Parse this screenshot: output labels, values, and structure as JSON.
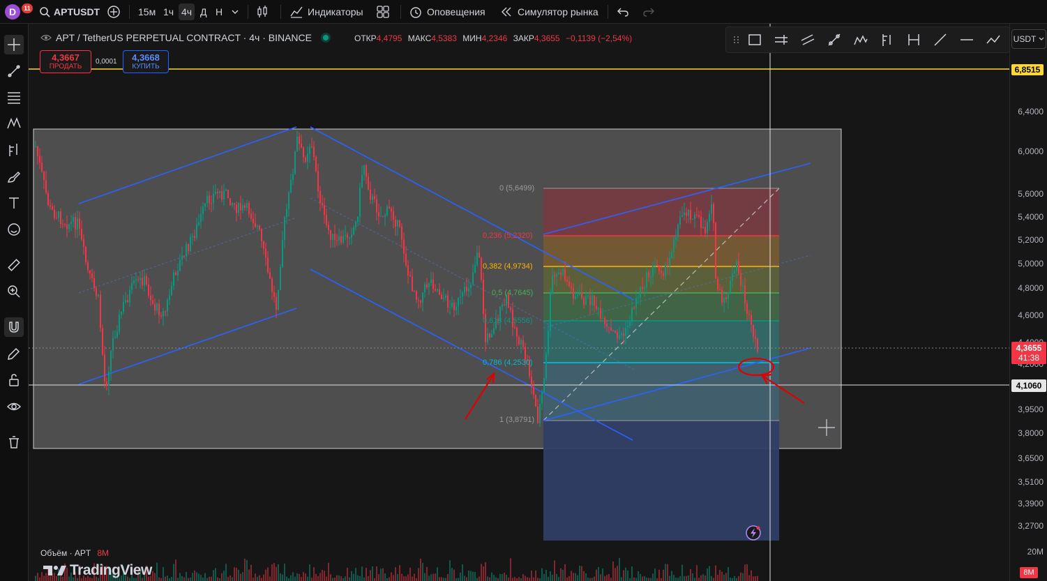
{
  "topbar": {
    "avatar_letter": "D",
    "notifications": "11",
    "symbol": "APTUSDT",
    "timeframes": [
      "15м",
      "1ч",
      "4ч",
      "Д",
      "Н"
    ],
    "active_timeframe": "4ч",
    "indicators_label": "Индикаторы",
    "alerts_label": "Оповещения",
    "replay_label": "Симулятор рынка"
  },
  "legend": {
    "title": "APT / TetherUS PERPETUAL CONTRACT · 4ч · BINANCE",
    "open_label": "ОТКР",
    "open": "4,4795",
    "high_label": "МАКС",
    "high": "4,5383",
    "low_label": "МИН",
    "low": "4,2346",
    "close_label": "ЗАКР",
    "close": "4,3655",
    "change": "−0,1139 (−2,54%)"
  },
  "trade": {
    "sell_price": "4,3667",
    "sell_label": "ПРОДАТЬ",
    "spread": "0,0001",
    "buy_price": "4,3668",
    "buy_label": "КУПИТЬ"
  },
  "price_axis": {
    "currency": "USDT",
    "labels": [
      "6,4000",
      "6,0000",
      "5,6000",
      "5,4000",
      "5,2000",
      "5,0000",
      "4,8000",
      "4,6000",
      "4,4000",
      "4,2000",
      "3,9500",
      "3,8000",
      "3,6500",
      "3,5100",
      "3,3900",
      "3,2700",
      "20M"
    ],
    "alert_price": "6,8515",
    "current_price": "4,3655",
    "countdown": "41:38",
    "crosshair_price": "4,1060",
    "volume_current": "8M"
  },
  "fibonacci": [
    {
      "label": "0 (5,6499)",
      "color": "#787b86"
    },
    {
      "label": "0,236 (5,2320)",
      "color": "#f23645"
    },
    {
      "label": "0,382 (4,9734)",
      "color": "#ffb300"
    },
    {
      "label": "0,5 (4,7645)",
      "color": "#4caf50"
    },
    {
      "label": "0,618 (4,5556)",
      "color": "#089981"
    },
    {
      "label": "0,786 (4,2530)",
      "color": "#00bcd4"
    },
    {
      "label": "1 (3,8791)",
      "color": "#787b86"
    }
  ],
  "volume": {
    "label": "Объём · APT",
    "value": "8M"
  },
  "branding": {
    "logo_text": "TradingView"
  },
  "colors": {
    "up": "#089981",
    "down": "#f23645",
    "channel": "#2962ff",
    "alert_line": "#fdd835",
    "annotation": "#e00000"
  }
}
